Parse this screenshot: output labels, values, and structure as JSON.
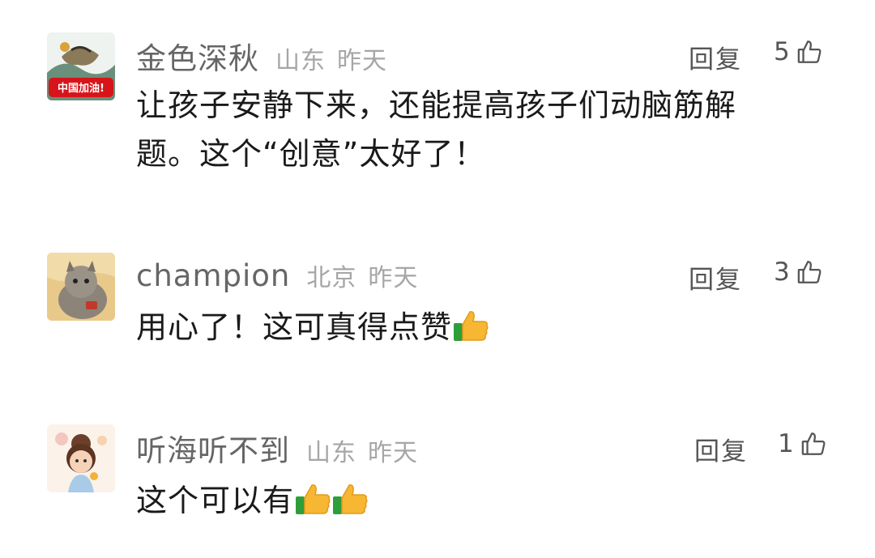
{
  "comments": [
    {
      "username": "金色深秋",
      "location": "山东",
      "time": "昨天",
      "reply_label": "回复",
      "likes": "5",
      "text_line1": "让孩子安静下来，还能提高孩子们动脑筋解",
      "text_line2": "题。这个“创意”太好了！",
      "avatar_badge": "中国加油!"
    },
    {
      "username": "champion",
      "location": "北京",
      "time": "昨天",
      "reply_label": "回复",
      "likes": "3",
      "text": "用心了！这可真得点赞"
    },
    {
      "username": "听海听不到",
      "location": "山东",
      "time": "昨天",
      "reply_label": "回复",
      "likes": "1",
      "text": "这个可以有"
    }
  ],
  "icons": {
    "like": "thumbs-up-outline-icon",
    "emoji": "thumbs-up-emoji"
  }
}
